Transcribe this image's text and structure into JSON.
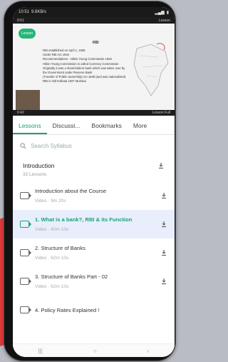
{
  "status": {
    "time": "10:51",
    "speed": "9.6KB/s",
    "battery": "4G"
  },
  "video": {
    "chip_label": "Lesson",
    "slide_title": "RBI",
    "notes": [
      "RBI established on April 1, 1935",
      "Under RBI Act 1934",
      "Recommendations - Hilton Young Commission 1926",
      "Hilton Young Commission is called Currency Commission",
      "Originally it was a shareholders bank which was taken over by the Government under Reserve Bank",
      "(Transfer of Public ownership) Act 1948 (and was nationalised)",
      "RBI in Old Kolkata    1937    Mumbai"
    ],
    "top_left": "8:51",
    "top_right": "Lesson",
    "bottom_left": "0:42",
    "bottom_right": "Lesson Full"
  },
  "tabs": [
    {
      "label": "Lessons",
      "active": true
    },
    {
      "label": "Discussi..."
    },
    {
      "label": "Bookmarks"
    },
    {
      "label": "More"
    }
  ],
  "search": {
    "placeholder": "Search Syllabus"
  },
  "section": {
    "title": "Introduction",
    "sub": "32 Lessons"
  },
  "lessons": [
    {
      "title": "Introduction about the Course",
      "duration": "Video · 9m 20s",
      "active": false
    },
    {
      "title": "1. What is a bank?, RBI & its Function",
      "duration": "Video · 40m 10s",
      "active": true
    },
    {
      "title": "2. Structure of Banks",
      "duration": "Video · 62m 10s",
      "active": false
    },
    {
      "title": "3. Structure of Banks Part - 02",
      "duration": "Video · 62m 10s",
      "active": false
    },
    {
      "title": "4. Policy Rates Explained !",
      "duration": "",
      "active": false
    }
  ],
  "colors": {
    "accent": "#16a37a",
    "active_bg": "#e8eefc"
  }
}
